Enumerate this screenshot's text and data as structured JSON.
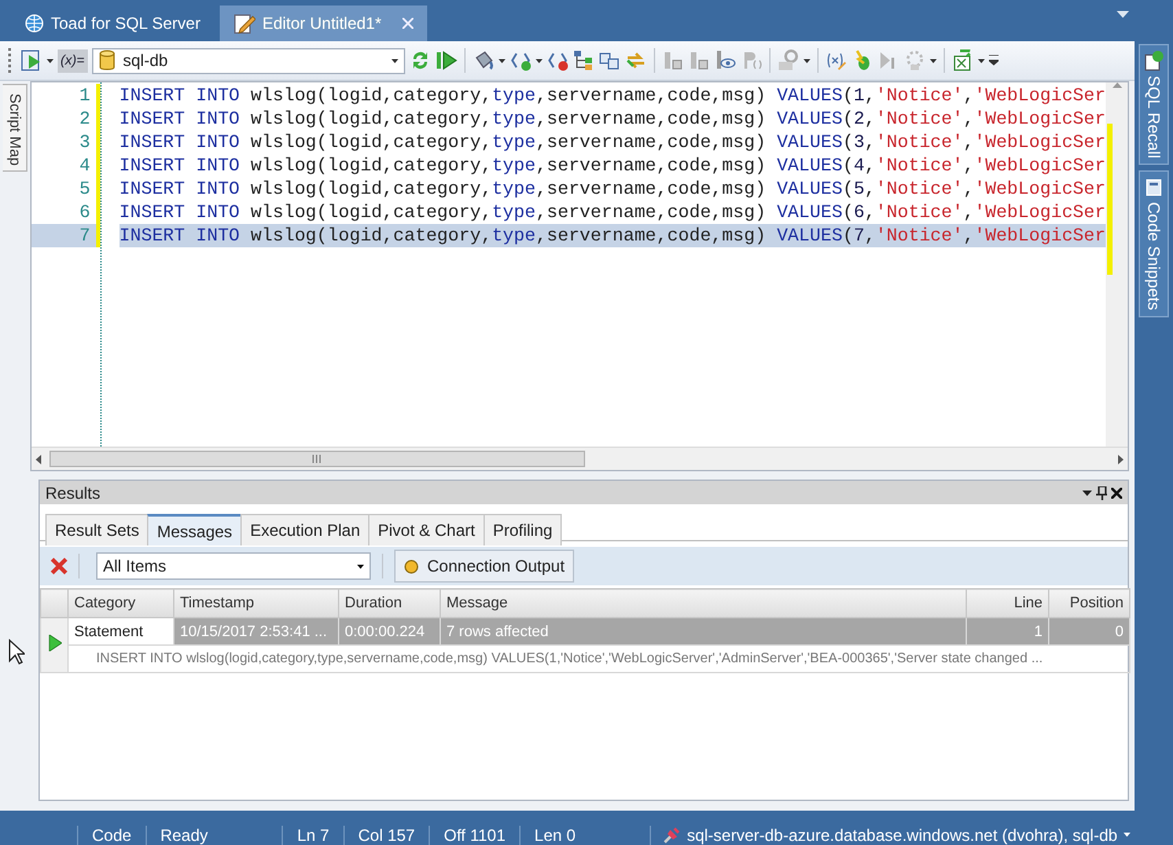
{
  "window_tabs": [
    {
      "label": "Toad for SQL Server",
      "selected": false
    },
    {
      "label": "Editor Untitled1*",
      "selected": true
    }
  ],
  "toolbar": {
    "variable_toggle": "(x)=",
    "connection": "sql-db"
  },
  "script_map": {
    "label": "Script Map"
  },
  "side_panels": [
    {
      "label": "SQL Recall"
    },
    {
      "label": "Code Snippets"
    }
  ],
  "editor": {
    "lines": [
      {
        "number": "1",
        "selected": false,
        "tokens": [
          {
            "kind": "kw",
            "text": "INSERT INTO"
          },
          {
            "kind": "id",
            "text": " wlslog(logid,category,"
          },
          {
            "kind": "kw",
            "text": "type"
          },
          {
            "kind": "id",
            "text": ",servername,code,msg) "
          },
          {
            "kind": "kw",
            "text": "VALUES"
          },
          {
            "kind": "id",
            "text": "("
          },
          {
            "kind": "num",
            "text": "1"
          },
          {
            "kind": "id",
            "text": ","
          },
          {
            "kind": "str",
            "text": "'Notice'"
          },
          {
            "kind": "id",
            "text": ","
          },
          {
            "kind": "str",
            "text": "'WebLogicSer"
          }
        ]
      },
      {
        "number": "2",
        "selected": false,
        "tokens": [
          {
            "kind": "kw",
            "text": "INSERT INTO"
          },
          {
            "kind": "id",
            "text": " wlslog(logid,category,"
          },
          {
            "kind": "kw",
            "text": "type"
          },
          {
            "kind": "id",
            "text": ",servername,code,msg) "
          },
          {
            "kind": "kw",
            "text": "VALUES"
          },
          {
            "kind": "id",
            "text": "("
          },
          {
            "kind": "num",
            "text": "2"
          },
          {
            "kind": "id",
            "text": ","
          },
          {
            "kind": "str",
            "text": "'Notice'"
          },
          {
            "kind": "id",
            "text": ","
          },
          {
            "kind": "str",
            "text": "'WebLogicSer"
          }
        ]
      },
      {
        "number": "3",
        "selected": false,
        "tokens": [
          {
            "kind": "kw",
            "text": "INSERT INTO"
          },
          {
            "kind": "id",
            "text": " wlslog(logid,category,"
          },
          {
            "kind": "kw",
            "text": "type"
          },
          {
            "kind": "id",
            "text": ",servername,code,msg) "
          },
          {
            "kind": "kw",
            "text": "VALUES"
          },
          {
            "kind": "id",
            "text": "("
          },
          {
            "kind": "num",
            "text": "3"
          },
          {
            "kind": "id",
            "text": ","
          },
          {
            "kind": "str",
            "text": "'Notice'"
          },
          {
            "kind": "id",
            "text": ","
          },
          {
            "kind": "str",
            "text": "'WebLogicSer"
          }
        ]
      },
      {
        "number": "4",
        "selected": false,
        "tokens": [
          {
            "kind": "kw",
            "text": "INSERT INTO"
          },
          {
            "kind": "id",
            "text": " wlslog(logid,category,"
          },
          {
            "kind": "kw",
            "text": "type"
          },
          {
            "kind": "id",
            "text": ",servername,code,msg) "
          },
          {
            "kind": "kw",
            "text": "VALUES"
          },
          {
            "kind": "id",
            "text": "("
          },
          {
            "kind": "num",
            "text": "4"
          },
          {
            "kind": "id",
            "text": ","
          },
          {
            "kind": "str",
            "text": "'Notice'"
          },
          {
            "kind": "id",
            "text": ","
          },
          {
            "kind": "str",
            "text": "'WebLogicSer"
          }
        ]
      },
      {
        "number": "5",
        "selected": false,
        "tokens": [
          {
            "kind": "kw",
            "text": "INSERT INTO"
          },
          {
            "kind": "id",
            "text": " wlslog(logid,category,"
          },
          {
            "kind": "kw",
            "text": "type"
          },
          {
            "kind": "id",
            "text": ",servername,code,msg) "
          },
          {
            "kind": "kw",
            "text": "VALUES"
          },
          {
            "kind": "id",
            "text": "("
          },
          {
            "kind": "num",
            "text": "5"
          },
          {
            "kind": "id",
            "text": ","
          },
          {
            "kind": "str",
            "text": "'Notice'"
          },
          {
            "kind": "id",
            "text": ","
          },
          {
            "kind": "str",
            "text": "'WebLogicSer"
          }
        ]
      },
      {
        "number": "6",
        "selected": false,
        "tokens": [
          {
            "kind": "kw",
            "text": "INSERT INTO"
          },
          {
            "kind": "id",
            "text": " wlslog(logid,category,"
          },
          {
            "kind": "kw",
            "text": "type"
          },
          {
            "kind": "id",
            "text": ",servername,code,msg) "
          },
          {
            "kind": "kw",
            "text": "VALUES"
          },
          {
            "kind": "id",
            "text": "("
          },
          {
            "kind": "num",
            "text": "6"
          },
          {
            "kind": "id",
            "text": ","
          },
          {
            "kind": "str",
            "text": "'Notice'"
          },
          {
            "kind": "id",
            "text": ","
          },
          {
            "kind": "str",
            "text": "'WebLogicSer"
          }
        ]
      },
      {
        "number": "7",
        "selected": true,
        "tokens": [
          {
            "kind": "kw",
            "text": "INSERT INTO"
          },
          {
            "kind": "id",
            "text": " wlslog(logid,category,"
          },
          {
            "kind": "kw",
            "text": "type"
          },
          {
            "kind": "id",
            "text": ",servername,code,msg) "
          },
          {
            "kind": "kw",
            "text": "VALUES"
          },
          {
            "kind": "id",
            "text": "("
          },
          {
            "kind": "num",
            "text": "7"
          },
          {
            "kind": "id",
            "text": ","
          },
          {
            "kind": "str",
            "text": "'Notice'"
          },
          {
            "kind": "id",
            "text": ","
          },
          {
            "kind": "str",
            "text": "'WebLogicSer"
          }
        ]
      }
    ]
  },
  "results": {
    "title": "Results",
    "tabs": [
      {
        "label": "Result Sets",
        "selected": false
      },
      {
        "label": "Messages",
        "selected": true
      },
      {
        "label": "Execution Plan",
        "selected": false
      },
      {
        "label": "Pivot & Chart",
        "selected": false
      },
      {
        "label": "Profiling",
        "selected": false
      }
    ],
    "filter": "All Items",
    "output_button": "Connection Output",
    "columns": [
      "Category",
      "Timestamp",
      "Duration",
      "Message",
      "Line",
      "Position"
    ],
    "rows": [
      {
        "selected": true,
        "cells": [
          "Statement",
          "10/15/2017 2:53:41 ...",
          "0:00:00.224",
          "7 rows affected",
          "1",
          "0"
        ],
        "detail": "INSERT INTO wlslog(logid,category,type,servername,code,msg) VALUES(1,'Notice','WebLogicServer','AdminServer','BEA-000365','Server state changed ..."
      }
    ]
  },
  "status_bar": {
    "items": [
      "Code",
      "Ready",
      "Ln 7",
      "Col 157",
      "Off 1101",
      "Len 0"
    ],
    "connection": "sql-server-db-azure.database.windows.net (dvohra), sql-db"
  }
}
